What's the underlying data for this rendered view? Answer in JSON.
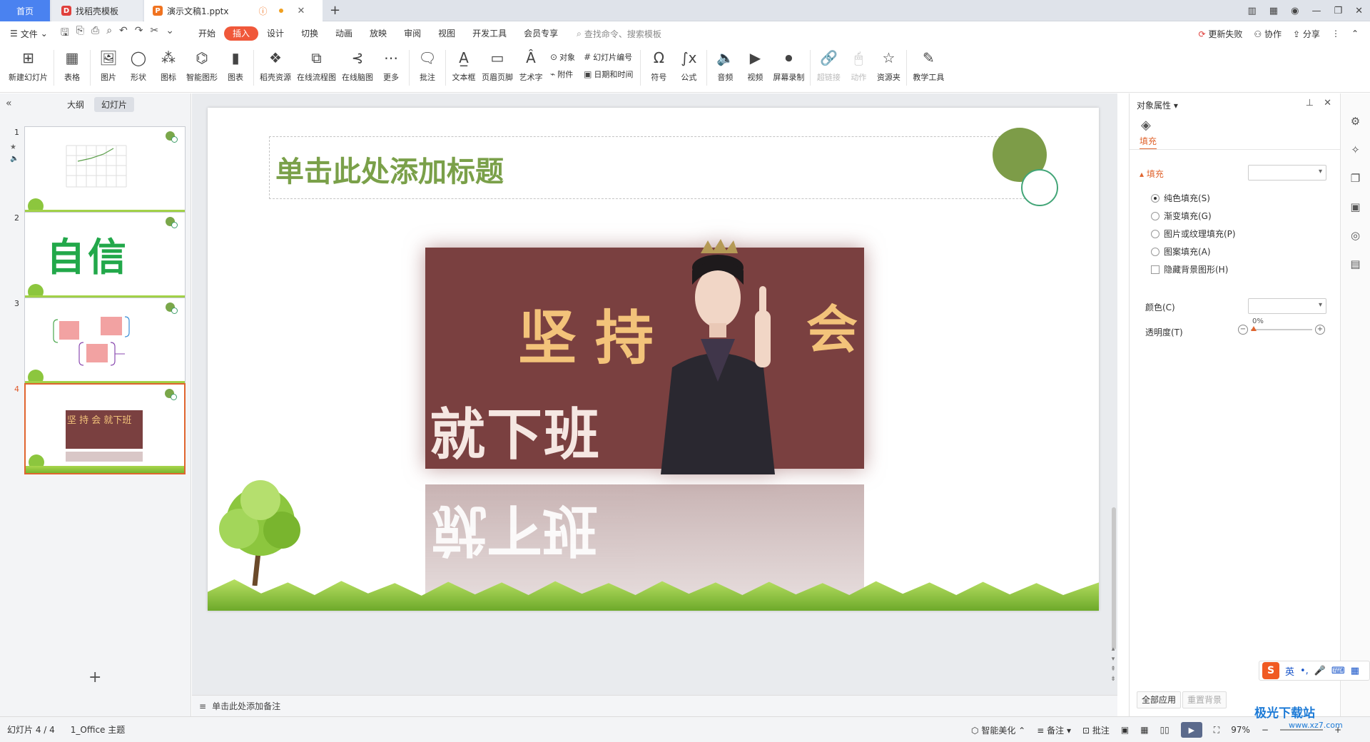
{
  "tabs": {
    "home": "首页",
    "template": "找稻壳模板",
    "document": "演示文稿1.pptx"
  },
  "menu": {
    "file": "文件",
    "tabs": [
      "开始",
      "插入",
      "设计",
      "切换",
      "动画",
      "放映",
      "审阅",
      "视图",
      "开发工具",
      "会员专享"
    ],
    "active_tab": "插入",
    "search_placeholder": "查找命令、搜索模板",
    "update_failed": "更新失败",
    "collaborate": "协作",
    "share": "分享"
  },
  "ribbon": {
    "new_slide": "新建幻灯片",
    "table": "表格",
    "picture": "图片",
    "shape": "形状",
    "icon": "图标",
    "smart_graphic": "智能图形",
    "chart": "图表",
    "docer_resource": "稻壳资源",
    "online_flowchart": "在线流程图",
    "online_mindmap": "在线脑图",
    "more": "更多",
    "comment": "批注",
    "textbox": "文本框",
    "header_footer": "页眉页脚",
    "wordart": "艺术字",
    "object": "对象",
    "attachment": "附件",
    "slide_number": "幻灯片编号",
    "date_time": "日期和时间",
    "symbol": "符号",
    "formula": "公式",
    "audio": "音频",
    "video": "视频",
    "screen_record": "屏幕录制",
    "hyperlink": "超链接",
    "action": "动作",
    "resource_folder": "资源夹",
    "teaching_tools": "教学工具"
  },
  "left_panel": {
    "outline_tab": "大纲",
    "slides_tab": "幻灯片",
    "slides": [
      {
        "number": "1",
        "text": ""
      },
      {
        "number": "2",
        "text": "自信"
      },
      {
        "number": "3",
        "text": ""
      },
      {
        "number": "4",
        "text": "坚 持 会 就下班"
      }
    ]
  },
  "slide": {
    "title": "单击此处添加标题",
    "picture_text_top": "坚持",
    "picture_text_right": "会",
    "picture_text_bottom": "就下班",
    "notes_placeholder": "单击此处添加备注"
  },
  "properties": {
    "header": "对象属性",
    "fill_tab": "填充",
    "fill_section": "填充",
    "options": [
      "纯色填充(S)",
      "渐变填充(G)",
      "图片或纹理填充(P)",
      "图案填充(A)"
    ],
    "selected_option": "纯色填充(S)",
    "hide_bg": "隐藏背景图形(H)",
    "color_label": "颜色(C)",
    "transparency_label": "透明度(T)",
    "transparency_value": "0%",
    "apply_all": "全部应用",
    "reset_bg": "重置背景"
  },
  "ime": {
    "mode": "英"
  },
  "status": {
    "slide_count": "幻灯片 4 / 4",
    "theme": "1_Office 主题",
    "smart_beautify": "智能美化",
    "notes": "备注",
    "comments": "批注",
    "zoom": "97%"
  },
  "watermark": {
    "text": "极光下载站",
    "url": "www.xz7.com"
  },
  "colors": {
    "accent": "#f0583a",
    "title_green": "#7aa049",
    "picture_bg": "#7a4040",
    "picture_text": "#f3c37a"
  }
}
